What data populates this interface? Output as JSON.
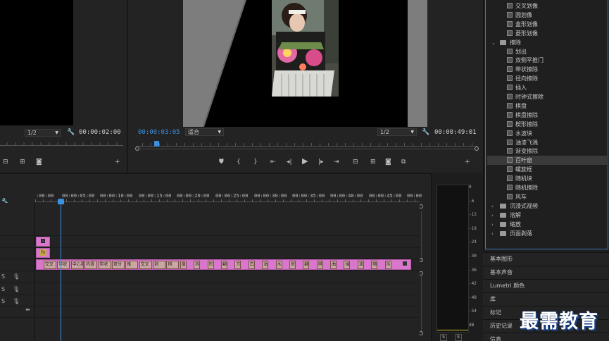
{
  "source_monitor": {
    "fit": "1/2",
    "timecode": "00:00:02:00"
  },
  "program_monitor": {
    "current_timecode": "00:00:03:05",
    "zoom": "适合",
    "fit": "1/2",
    "duration": "00:00:49:01"
  },
  "effects": {
    "items": [
      {
        "type": "effect",
        "label": "交叉划像",
        "indent": 1
      },
      {
        "type": "effect",
        "label": "圆划像",
        "indent": 1
      },
      {
        "type": "effect",
        "label": "盒形划像",
        "indent": 1
      },
      {
        "type": "effect",
        "label": "菱形划像",
        "indent": 1
      },
      {
        "type": "folder",
        "label": "擦除",
        "expanded": true
      },
      {
        "type": "effect",
        "label": "划出",
        "indent": 1
      },
      {
        "type": "effect",
        "label": "双侧平推门",
        "indent": 1
      },
      {
        "type": "effect",
        "label": "带状擦除",
        "indent": 1
      },
      {
        "type": "effect",
        "label": "径向擦除",
        "indent": 1
      },
      {
        "type": "effect",
        "label": "插入",
        "indent": 1
      },
      {
        "type": "effect",
        "label": "时钟式擦除",
        "indent": 1
      },
      {
        "type": "effect",
        "label": "棋盘",
        "indent": 1
      },
      {
        "type": "effect",
        "label": "棋盘擦除",
        "indent": 1
      },
      {
        "type": "effect",
        "label": "楔形擦除",
        "indent": 1
      },
      {
        "type": "effect",
        "label": "水波块",
        "indent": 1
      },
      {
        "type": "effect",
        "label": "油漆飞溅",
        "indent": 1
      },
      {
        "type": "effect",
        "label": "渐变擦除",
        "indent": 1
      },
      {
        "type": "effect",
        "label": "百叶窗",
        "indent": 1,
        "selected": true
      },
      {
        "type": "effect",
        "label": "螺旋框",
        "indent": 1
      },
      {
        "type": "effect",
        "label": "随机块",
        "indent": 1
      },
      {
        "type": "effect",
        "label": "随机擦除",
        "indent": 1
      },
      {
        "type": "effect",
        "label": "风车",
        "indent": 1
      },
      {
        "type": "folder",
        "label": "沉浸式视频",
        "expanded": false
      },
      {
        "type": "folder",
        "label": "溶解",
        "expanded": false
      },
      {
        "type": "folder",
        "label": "缩放",
        "expanded": false
      },
      {
        "type": "folder",
        "label": "页面剥落",
        "expanded": false
      }
    ]
  },
  "side_panels": [
    "基本图形",
    "基本声音",
    "Lumetri 颜色",
    "库",
    "标记",
    "历史记录",
    "信息"
  ],
  "timeline": {
    "ruler_labels": [
      ":00:00",
      "00:00:05:00",
      "00:00:10:00",
      "00:00:15:00",
      "00:00:20:00",
      "00:00:25:00",
      "00:00:30:00",
      "00:00:35:00",
      "00:00:40:00",
      "00:00:45:00",
      "00:00"
    ],
    "track_labels": [
      "S",
      "S",
      "S"
    ],
    "clip_small_labels": [
      "交叉",
      "带状",
      "中心剥",
      "内滑",
      "带状",
      "双分",
      "推",
      "交叉",
      "剥",
      "棋",
      "盘",
      "拆",
      "形",
      "翻",
      "方",
      "白",
      "油",
      "水",
      "掠",
      "翻",
      "棋",
      "曲",
      "插",
      "波",
      "随",
      "拆"
    ],
    "fx_badge": "fx"
  },
  "meter": {
    "db_labels": [
      "0",
      "-6",
      "-12",
      "-18",
      "-24",
      "-30",
      "-36",
      "-42",
      "-48",
      "-54",
      "dB"
    ],
    "solo_labels": [
      "S",
      "S"
    ]
  },
  "watermark": "最需教育"
}
